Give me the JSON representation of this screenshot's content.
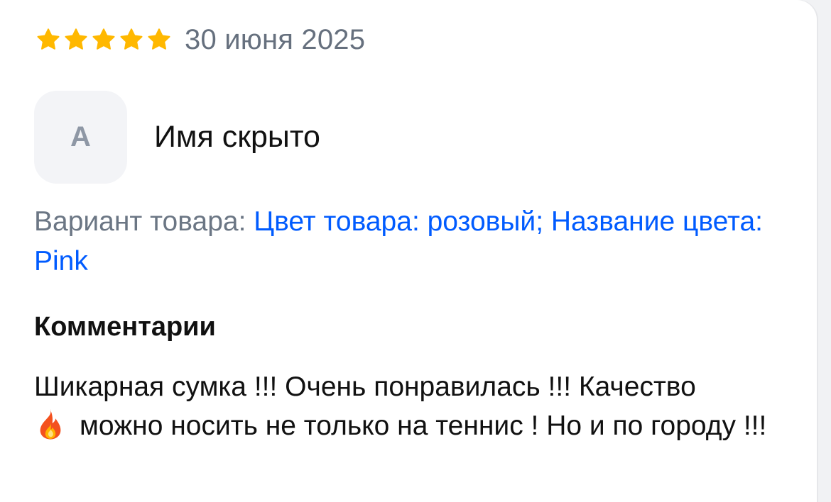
{
  "review": {
    "rating": 5,
    "rating_max": 5,
    "date": "30 июня 2025",
    "author": {
      "initial": "А",
      "name": "Имя скрыто"
    },
    "variant": {
      "label": "Вариант товара: ",
      "value": "Цвет товара: розовый; Название цвета: Pink"
    },
    "comments": {
      "title": "Комментарии",
      "text_part1": "Шикарная сумка !!! Очень понравилась !!! Качество",
      "emoji_icon": "fire-icon",
      "text_part2": "можно носить не только на теннис ! Но и по городу !!!"
    }
  },
  "colors": {
    "star": "#FFB800",
    "link": "#005BFF",
    "muted": "#6B7684",
    "avatar_bg": "#F3F4F7"
  }
}
